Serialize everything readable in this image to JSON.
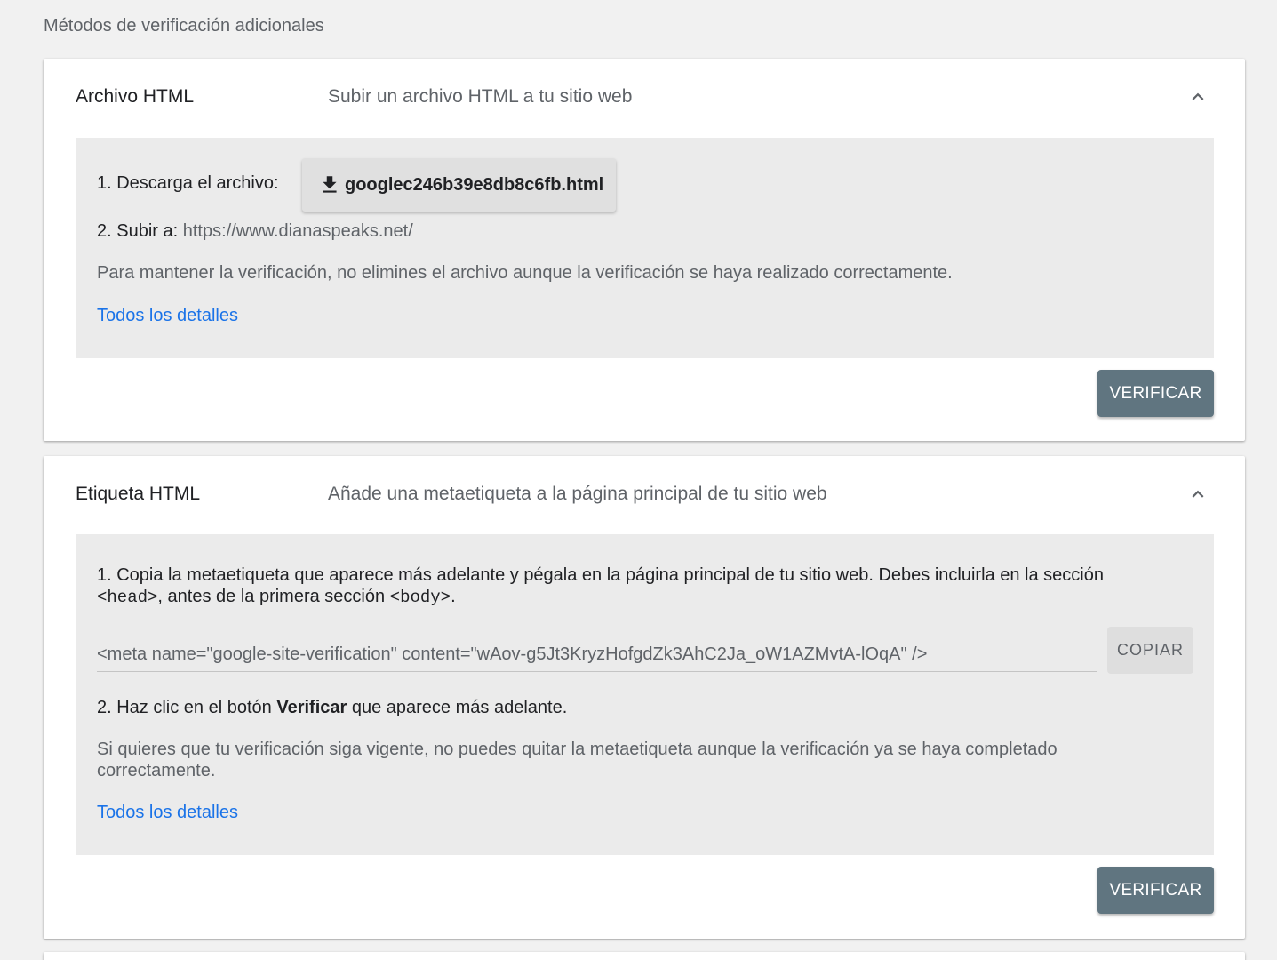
{
  "section_title": "Métodos de verificación adicionales",
  "colors": {
    "background": "#f1f1f1",
    "panel": "#ebebeb",
    "link": "#1a73e8",
    "verify_button": "#607580"
  },
  "card_file": {
    "name": "Archivo HTML",
    "description": "Subir un archivo HTML a tu sitio web",
    "chevron_icon": "chevron-up-icon",
    "step1_label": "1. Descarga el archivo:",
    "download_icon": "download-icon",
    "file_name": "googlec246b39e8db8c6fb.html",
    "step2_label": "2. Subir a:",
    "step2_url": "https://www.dianaspeaks.net/",
    "note": "Para mantener la verificación, no elimines el archivo aunque la verificación se haya realizado correctamente.",
    "details_link": "Todos los detalles",
    "verify_button": "VERIFICAR"
  },
  "card_tag": {
    "name": "Etiqueta HTML",
    "description": "Añade una metaetiqueta a la página principal de tu sitio web",
    "chevron_icon": "chevron-up-icon",
    "step1_text": "1. Copia la metaetiqueta que aparece más adelante y pégala en la página principal de tu sitio web. Debes incluirla en la sección",
    "step1_head_tag": "<head>",
    "step1_middle": ", antes de la primera sección ",
    "step1_body_tag": "<body>",
    "step1_end": ".",
    "meta_value": "<meta name=\"google-site-verification\" content=\"wAov-g5Jt3KryzHofgdZk3AhC2Ja_oW1AZMvtA-lOqA\" />",
    "copy_button": "COPIAR",
    "step2_prefix": "2. Haz clic en el botón ",
    "step2_bold": "Verificar",
    "step2_suffix": " que aparece más adelante.",
    "note_line1": "Si quieres que tu verificación siga vigente, no puedes quitar la metaetiqueta aunque la verificación ya se haya completado",
    "note_line2": "correctamente.",
    "details_link": "Todos los detalles",
    "verify_button": "VERIFICAR"
  }
}
